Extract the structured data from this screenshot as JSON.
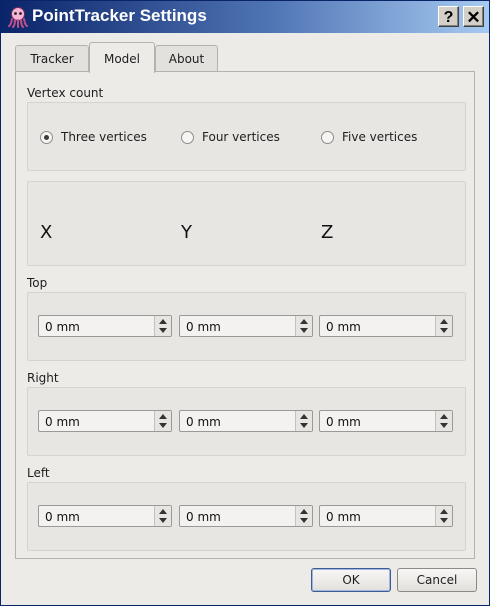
{
  "window": {
    "title": "PointTracker Settings",
    "help_label": "?",
    "close_label": "✕",
    "icon": "octopus-icon"
  },
  "tabs": [
    {
      "label": "Tracker",
      "active": false
    },
    {
      "label": "Model",
      "active": true
    },
    {
      "label": "About",
      "active": false
    }
  ],
  "vertex_count": {
    "label": "Vertex count",
    "options": [
      {
        "label": "Three vertices",
        "selected": true
      },
      {
        "label": "Four vertices",
        "selected": false
      },
      {
        "label": "Five vertices",
        "selected": false
      }
    ]
  },
  "axes": {
    "x": "X",
    "y": "Y",
    "z": "Z"
  },
  "points": [
    {
      "label": "Top",
      "x": "0 mm",
      "y": "0 mm",
      "z": "0 mm"
    },
    {
      "label": "Right",
      "x": "0 mm",
      "y": "0 mm",
      "z": "0 mm"
    },
    {
      "label": "Left",
      "x": "0 mm",
      "y": "0 mm",
      "z": "0 mm"
    }
  ],
  "buttons": {
    "ok": "OK",
    "cancel": "Cancel"
  }
}
